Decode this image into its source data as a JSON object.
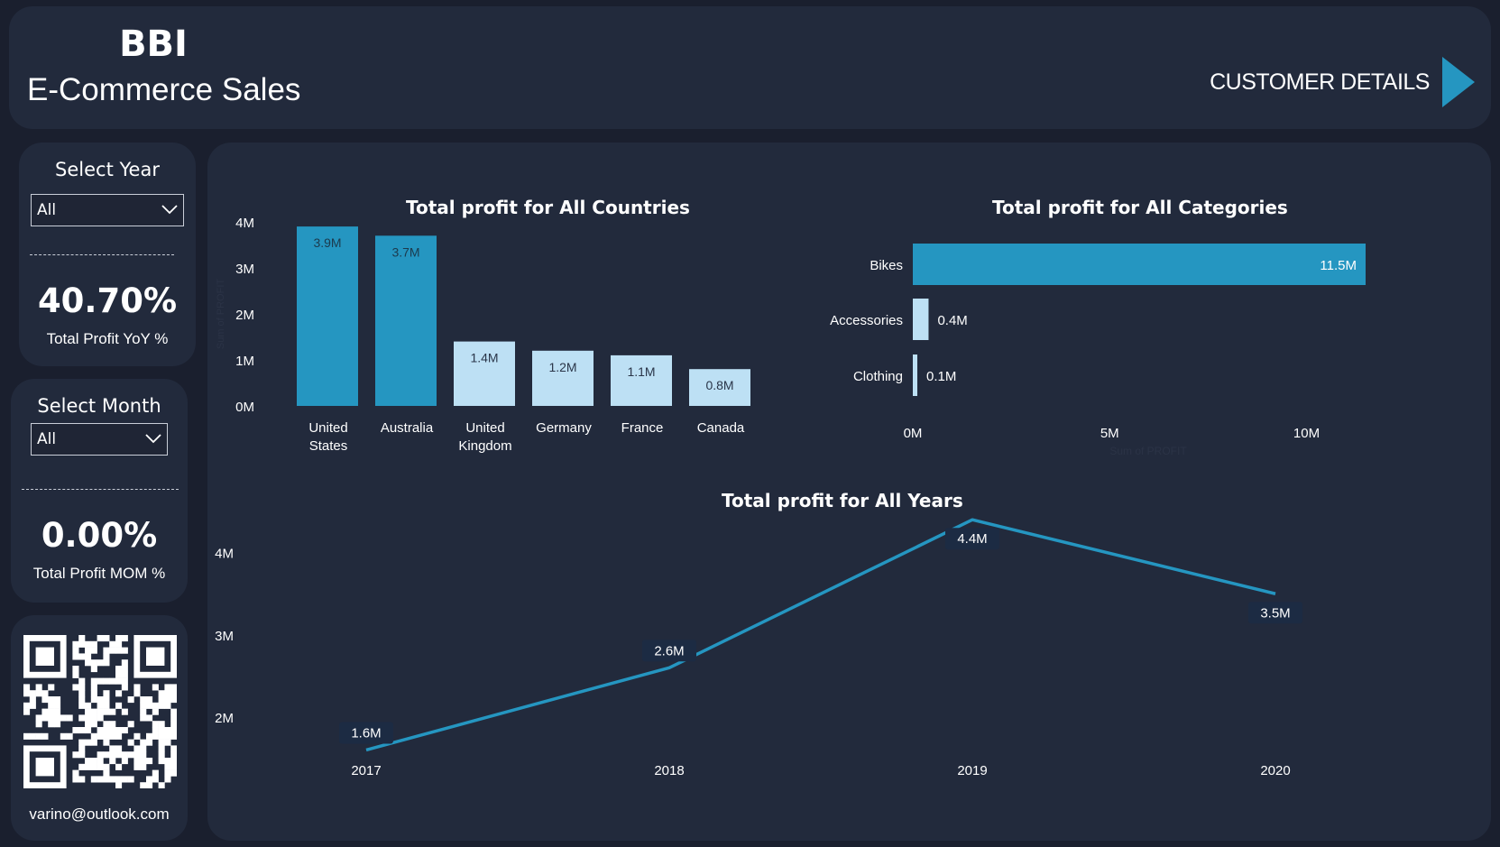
{
  "header": {
    "brand_abbr": "BBI",
    "brand_title": "E-Commerce Sales",
    "nav_label": "CUSTOMER DETAILS"
  },
  "filters": {
    "year": {
      "label": "Select Year",
      "value": "All"
    },
    "month": {
      "label": "Select Month",
      "value": "All"
    }
  },
  "kpis": {
    "yoy": {
      "value": "40.70%",
      "label": "Total Profit YoY %"
    },
    "mom": {
      "value": "0.00%",
      "label": "Total Profit MOM %"
    }
  },
  "contact": {
    "email": "varino@outlook.com"
  },
  "colors": {
    "accent": "#2596c1",
    "panel": "#222a3c",
    "background": "#1a1f2e",
    "light_bar": "#bde0f4"
  },
  "chart_data": [
    {
      "type": "bar",
      "title": "Total profit for All Countries",
      "xlabel": "",
      "ylabel": "Sum of PROFIT",
      "categories": [
        "United States",
        "Australia",
        "United Kingdom",
        "Germany",
        "France",
        "Canada"
      ],
      "values": [
        3.9,
        3.7,
        1.4,
        1.2,
        1.1,
        0.8
      ],
      "value_labels": [
        "3.9M",
        "3.7M",
        "1.4M",
        "1.2M",
        "1.1M",
        "0.8M"
      ],
      "unit": "M",
      "ylim": [
        0,
        4
      ],
      "yticks": [
        "0M",
        "1M",
        "2M",
        "3M",
        "4M"
      ]
    },
    {
      "type": "bar",
      "orientation": "horizontal",
      "title": "Total profit for All Categories",
      "xlabel": "Sum of PROFIT",
      "categories": [
        "Bikes",
        "Accessories",
        "Clothing"
      ],
      "values": [
        11.5,
        0.4,
        0.1
      ],
      "value_labels": [
        "11.5M",
        "0.4M",
        "0.1M"
      ],
      "unit": "M",
      "xlim": [
        0,
        11.5
      ],
      "xticks": [
        "0M",
        "5M",
        "10M"
      ]
    },
    {
      "type": "line",
      "title": "Total profit for All Years",
      "x": [
        "2017",
        "2018",
        "2019",
        "2020"
      ],
      "values": [
        1.6,
        2.6,
        4.4,
        3.5
      ],
      "value_labels": [
        "1.6M",
        "2.6M",
        "4.4M",
        "3.5M"
      ],
      "unit": "M",
      "ylim": [
        1.55,
        4.6
      ],
      "yticks": [
        "2M",
        "3M",
        "4M"
      ]
    }
  ]
}
